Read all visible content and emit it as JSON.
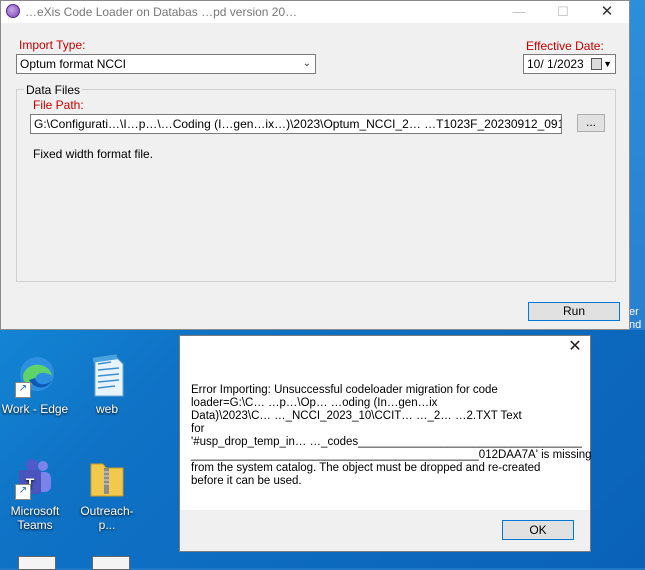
{
  "window": {
    "title": "…eXis Code Loader on Databas   …pd version 20…",
    "minimize": "—",
    "maximize": "☐",
    "close": "✕"
  },
  "import_type": {
    "label": "Import Type:",
    "value": "Optum format NCCI"
  },
  "effective_date": {
    "label": "Effective Date:",
    "value": "10/  1/2023"
  },
  "data_files": {
    "group_label": "Data Files",
    "file_path_label": "File Path:",
    "file_path_value": "G:\\Configurati…\\I…p…\\…Coding (I…gen…ix…)\\2023\\Optum_NCCI_2…          …T1023F_20230912_091",
    "browse_label": "...",
    "format_note": "Fixed width format file."
  },
  "run_button": "Run",
  "desktop_icons": [
    {
      "label": "Work - Edge"
    },
    {
      "label": "web"
    },
    {
      "label": "Microsoft Teams"
    },
    {
      "label": "Outreach-p..."
    }
  ],
  "edge_text": [
    "er",
    "nd"
  ],
  "error_dialog": {
    "close": "✕",
    "lines": [
      "Error Importing: Unsuccessful codeloader migration for code",
      "loader=G:\\C…                …p…\\Op…  …oding (In…gen…ix",
      "Data)\\2023\\C…   …_NCCI_2023_10\\CCIT…   …_2…    …2.TXT Text",
      "for",
      "'#usp_drop_temp_in…     …_codes___________________________________",
      "_____________________________________________012DAA7A' is missing",
      "from the system catalog. The object must be dropped and re-created",
      "before it can be used."
    ],
    "ok_label": "OK"
  }
}
